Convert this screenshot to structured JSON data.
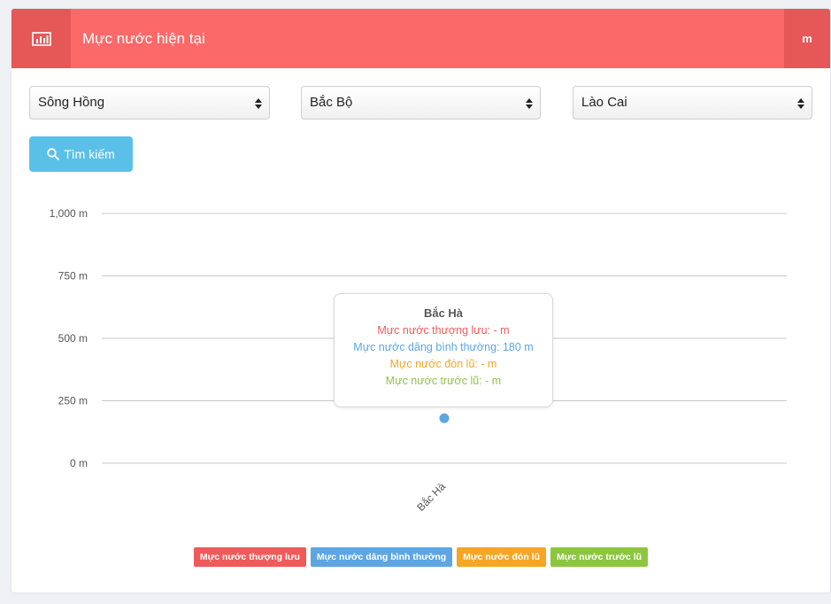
{
  "header": {
    "title": "Mực nước hiện tại",
    "unit": "m",
    "icon": "bar-chart-icon"
  },
  "filters": [
    {
      "name": "river-select",
      "value": "Sông Hồng"
    },
    {
      "name": "region-select",
      "value": "Bắc Bộ"
    },
    {
      "name": "province-select",
      "value": "Lào Cai"
    }
  ],
  "search": {
    "label": "Tìm kiếm",
    "icon": "search-icon"
  },
  "colors": {
    "header": "#fb6969",
    "upstream": "#f15a5a",
    "normal": "#5da6e2",
    "flood_alert": "#f5a623",
    "pre_flood": "#8cc63f"
  },
  "tooltip": {
    "title": "Bắc Hà",
    "lines": [
      "Mực nước thượng lưu: - m",
      "Mực nước dâng bình thường: 180 m",
      "Mực nước đón lũ: - m",
      "Mực nước trước lũ: - m"
    ]
  },
  "chart_data": {
    "type": "scatter",
    "categories": [
      "Bắc Hà"
    ],
    "series": [
      {
        "name": "Mực nước thượng lưu",
        "color": "#f15a5a",
        "values": [
          null
        ]
      },
      {
        "name": "Mực nước dâng bình thường",
        "color": "#5da6e2",
        "values": [
          180
        ]
      },
      {
        "name": "Mực nước đón lũ",
        "color": "#f5a623",
        "values": [
          null
        ]
      },
      {
        "name": "Mực nước trước lũ",
        "color": "#8cc63f",
        "values": [
          null
        ]
      }
    ],
    "yticks": [
      0,
      250,
      500,
      750,
      1000
    ],
    "ytick_labels": [
      "0 m",
      "250 m",
      "500 m",
      "750 m",
      "1,000 m"
    ],
    "ylim": [
      0,
      1000
    ],
    "grid": true,
    "legend_position": "bottom"
  }
}
